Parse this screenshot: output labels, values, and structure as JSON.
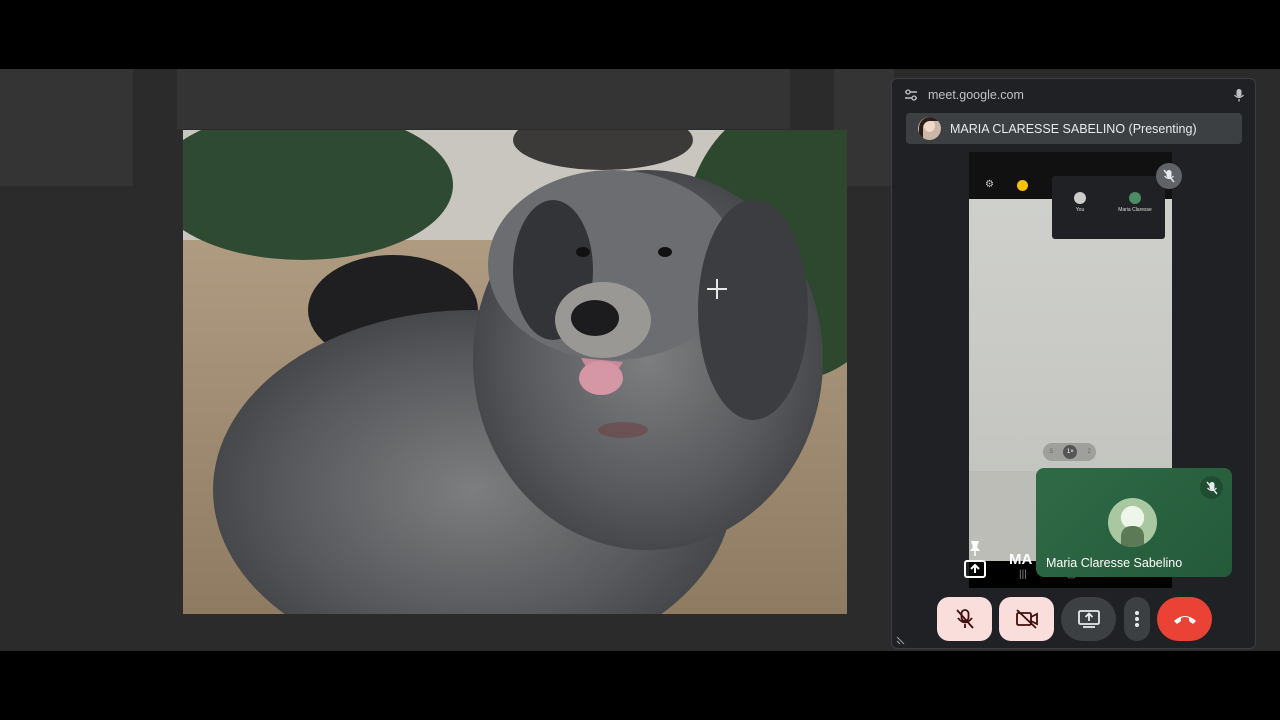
{
  "meet_window": {
    "url": "meet.google.com",
    "presenter_label": "MARIA CLARESSE SABELINO (Presenting)",
    "phone_preview": {
      "tile_you": "You",
      "tile_maria": "Maria Claresse",
      "zoom_left": ".5",
      "zoom_active": "1×",
      "zoom_right": "2",
      "name_fragment": "MA",
      "nav_recents": "|||",
      "nav_home": "▢",
      "nav_back": "<"
    },
    "self_view": {
      "name": "Maria Claresse Sabelino"
    },
    "controls": {
      "mic": "mic-off-icon",
      "camera": "camera-off-icon",
      "present": "present-screen-icon",
      "more": "more-vert-icon",
      "hangup": "call-end-icon"
    }
  },
  "colors": {
    "stage_bg": "#2b2b2b",
    "window_bg": "#202124",
    "toggle_off_bg": "#f9dedc",
    "hangup_red": "#ea4335",
    "self_tile_green": "#2f6a46"
  }
}
